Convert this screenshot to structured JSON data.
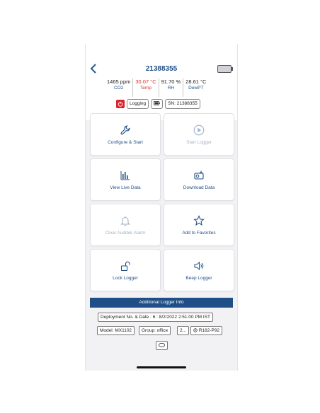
{
  "header": {
    "title": "21388355"
  },
  "readings": [
    {
      "value": "1465 ppm",
      "label": "CO2",
      "highlight": false
    },
    {
      "value": "30.07 °C",
      "label": "Temp",
      "highlight": true
    },
    {
      "value": "91.70 %",
      "label": "RH",
      "highlight": false
    },
    {
      "value": "28.61 °C",
      "label": "DewPT",
      "highlight": false
    }
  ],
  "status": {
    "logging_label": "Logging",
    "serial_label": "SN: 21388355"
  },
  "tiles": [
    {
      "label": "Configure & Start",
      "icon": "wrench-icon",
      "enabled": true
    },
    {
      "label": "Start Logger",
      "icon": "play-circle-icon",
      "enabled": false
    },
    {
      "label": "View Live Data",
      "icon": "bar-chart-icon",
      "enabled": true
    },
    {
      "label": "Download Data",
      "icon": "download-device-icon",
      "enabled": true
    },
    {
      "label": "Clear Audible Alarm",
      "icon": "bell-icon",
      "enabled": false
    },
    {
      "label": "Add to Favorites",
      "icon": "star-icon",
      "enabled": true
    },
    {
      "label": "Lock Logger",
      "icon": "unlock-icon",
      "enabled": true
    },
    {
      "label": "Beep Logger",
      "icon": "speaker-icon",
      "enabled": true
    }
  ],
  "info": {
    "header": "Additional Logger Info",
    "deployment": "Deployment No. & Date : 6 : 8/2/2022 2:51:00 PM IST",
    "model": "Model: MX1102",
    "group": "Group: office",
    "extra": "2...",
    "sensor": "R182-P92"
  },
  "colors": {
    "accent": "#1f4f86",
    "alert": "#d9322b",
    "record": "#d8232a"
  }
}
